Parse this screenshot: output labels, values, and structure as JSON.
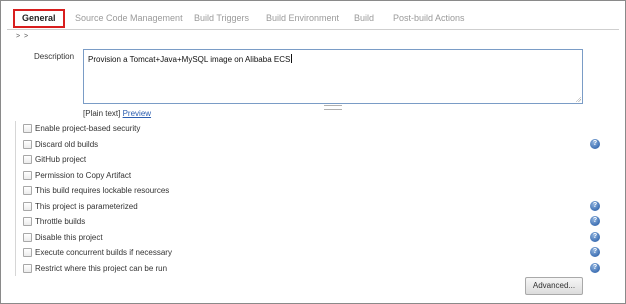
{
  "tabs": [
    {
      "label": "General"
    },
    {
      "label": "Source Code Management"
    },
    {
      "label": "Build Triggers"
    },
    {
      "label": "Build Environment"
    },
    {
      "label": "Build"
    },
    {
      "label": "Post-build Actions"
    }
  ],
  "collapse_marker": "> >",
  "description": {
    "label": "Description",
    "value": "Provision a Tomcat+Java+MySQL image on Alibaba ECS",
    "plain_text": "[Plain text]",
    "preview_link": "Preview"
  },
  "options": [
    {
      "label": "Enable project-based security",
      "help": false
    },
    {
      "label": "Discard old builds",
      "help": true
    },
    {
      "label": "GitHub project",
      "help": false
    },
    {
      "label": "Permission to Copy Artifact",
      "help": false
    },
    {
      "label": "This build requires lockable resources",
      "help": false
    },
    {
      "label": "This project is parameterized",
      "help": true
    },
    {
      "label": "Throttle builds",
      "help": true
    },
    {
      "label": "Disable this project",
      "help": true
    },
    {
      "label": "Execute concurrent builds if necessary",
      "help": true
    },
    {
      "label": "Restrict where this project can be run",
      "help": true
    }
  ],
  "help_glyph": "?",
  "advanced_button": "Advanced...",
  "colors": {
    "active_tab_border": "#d81e1e",
    "link": "#2a5db0",
    "help_icon": "#3d6fb3"
  }
}
